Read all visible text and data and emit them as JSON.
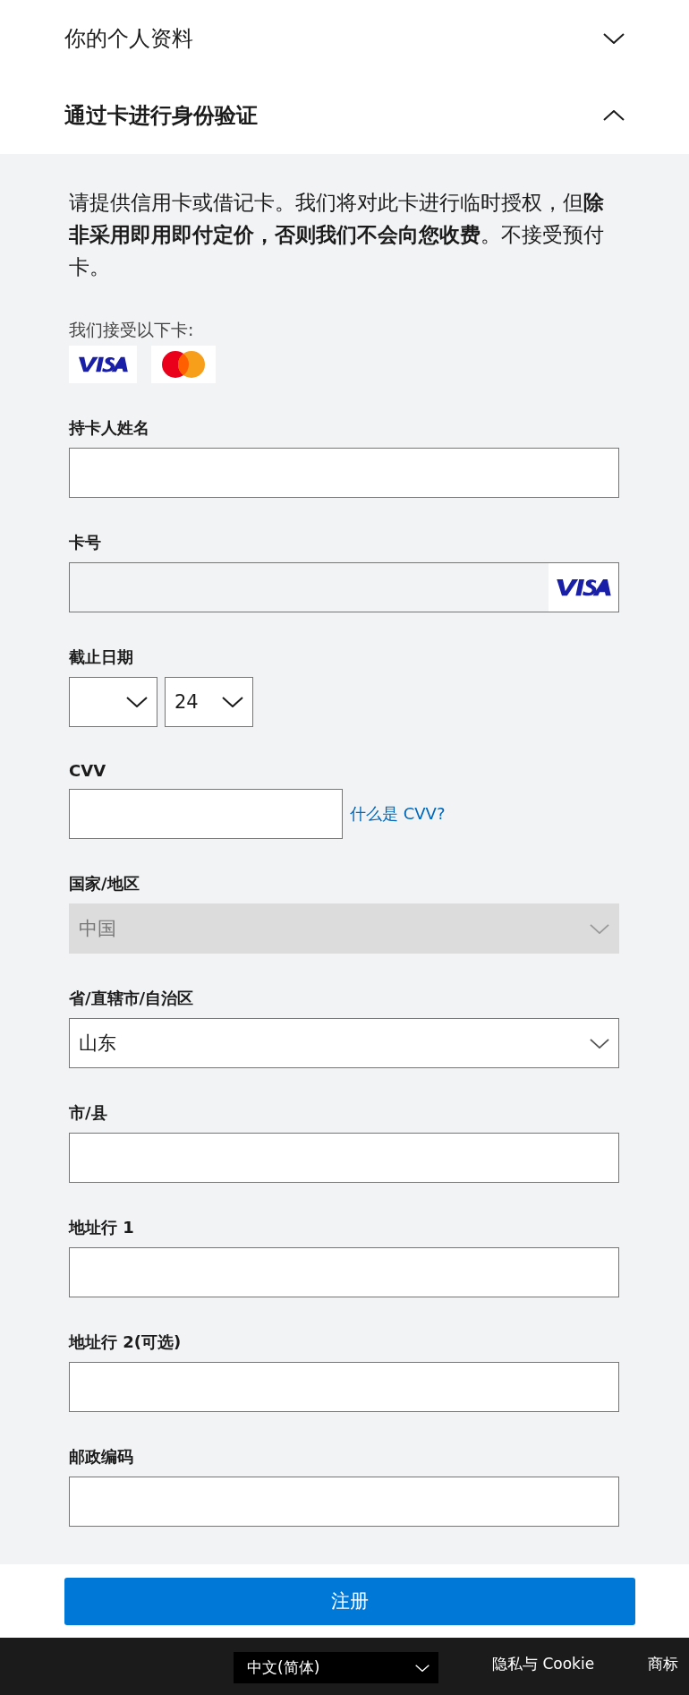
{
  "sections": [
    {
      "title": "你的个人资料",
      "expanded": false
    },
    {
      "title": "通过卡进行身份验证",
      "expanded": true
    }
  ],
  "intro": "请提供信用卡或借记卡。我们将对此卡进行临时授权，但**除非采用即用即付定价，否则我们不会向您收费**。不接受预付卡。",
  "accepted_label": "我们接受以下卡:",
  "fields": [
    {
      "kind": "text",
      "label": "持卡人姓名"
    },
    {
      "kind": "card",
      "label": "卡号"
    },
    {
      "kind": "expiry",
      "label": "截止日期",
      "year": "24"
    },
    {
      "kind": "cvv",
      "label": "CVV",
      "link": "什么是 CVV?"
    },
    {
      "kind": "select",
      "label": "国家/地区",
      "value": "中国",
      "disabled": true
    },
    {
      "kind": "select",
      "label": "省/直辖市/自治区",
      "value": "山东",
      "disabled": false
    },
    {
      "kind": "text",
      "label": "市/县"
    },
    {
      "kind": "text",
      "label": "地址行 1"
    },
    {
      "kind": "text",
      "label": "地址行 2(可选)"
    },
    {
      "kind": "text",
      "label": "邮政编码"
    }
  ],
  "submit": "注册",
  "footer": {
    "language": "中文(简体)",
    "links": [
      "隐私与 Cookie",
      "商标"
    ]
  }
}
